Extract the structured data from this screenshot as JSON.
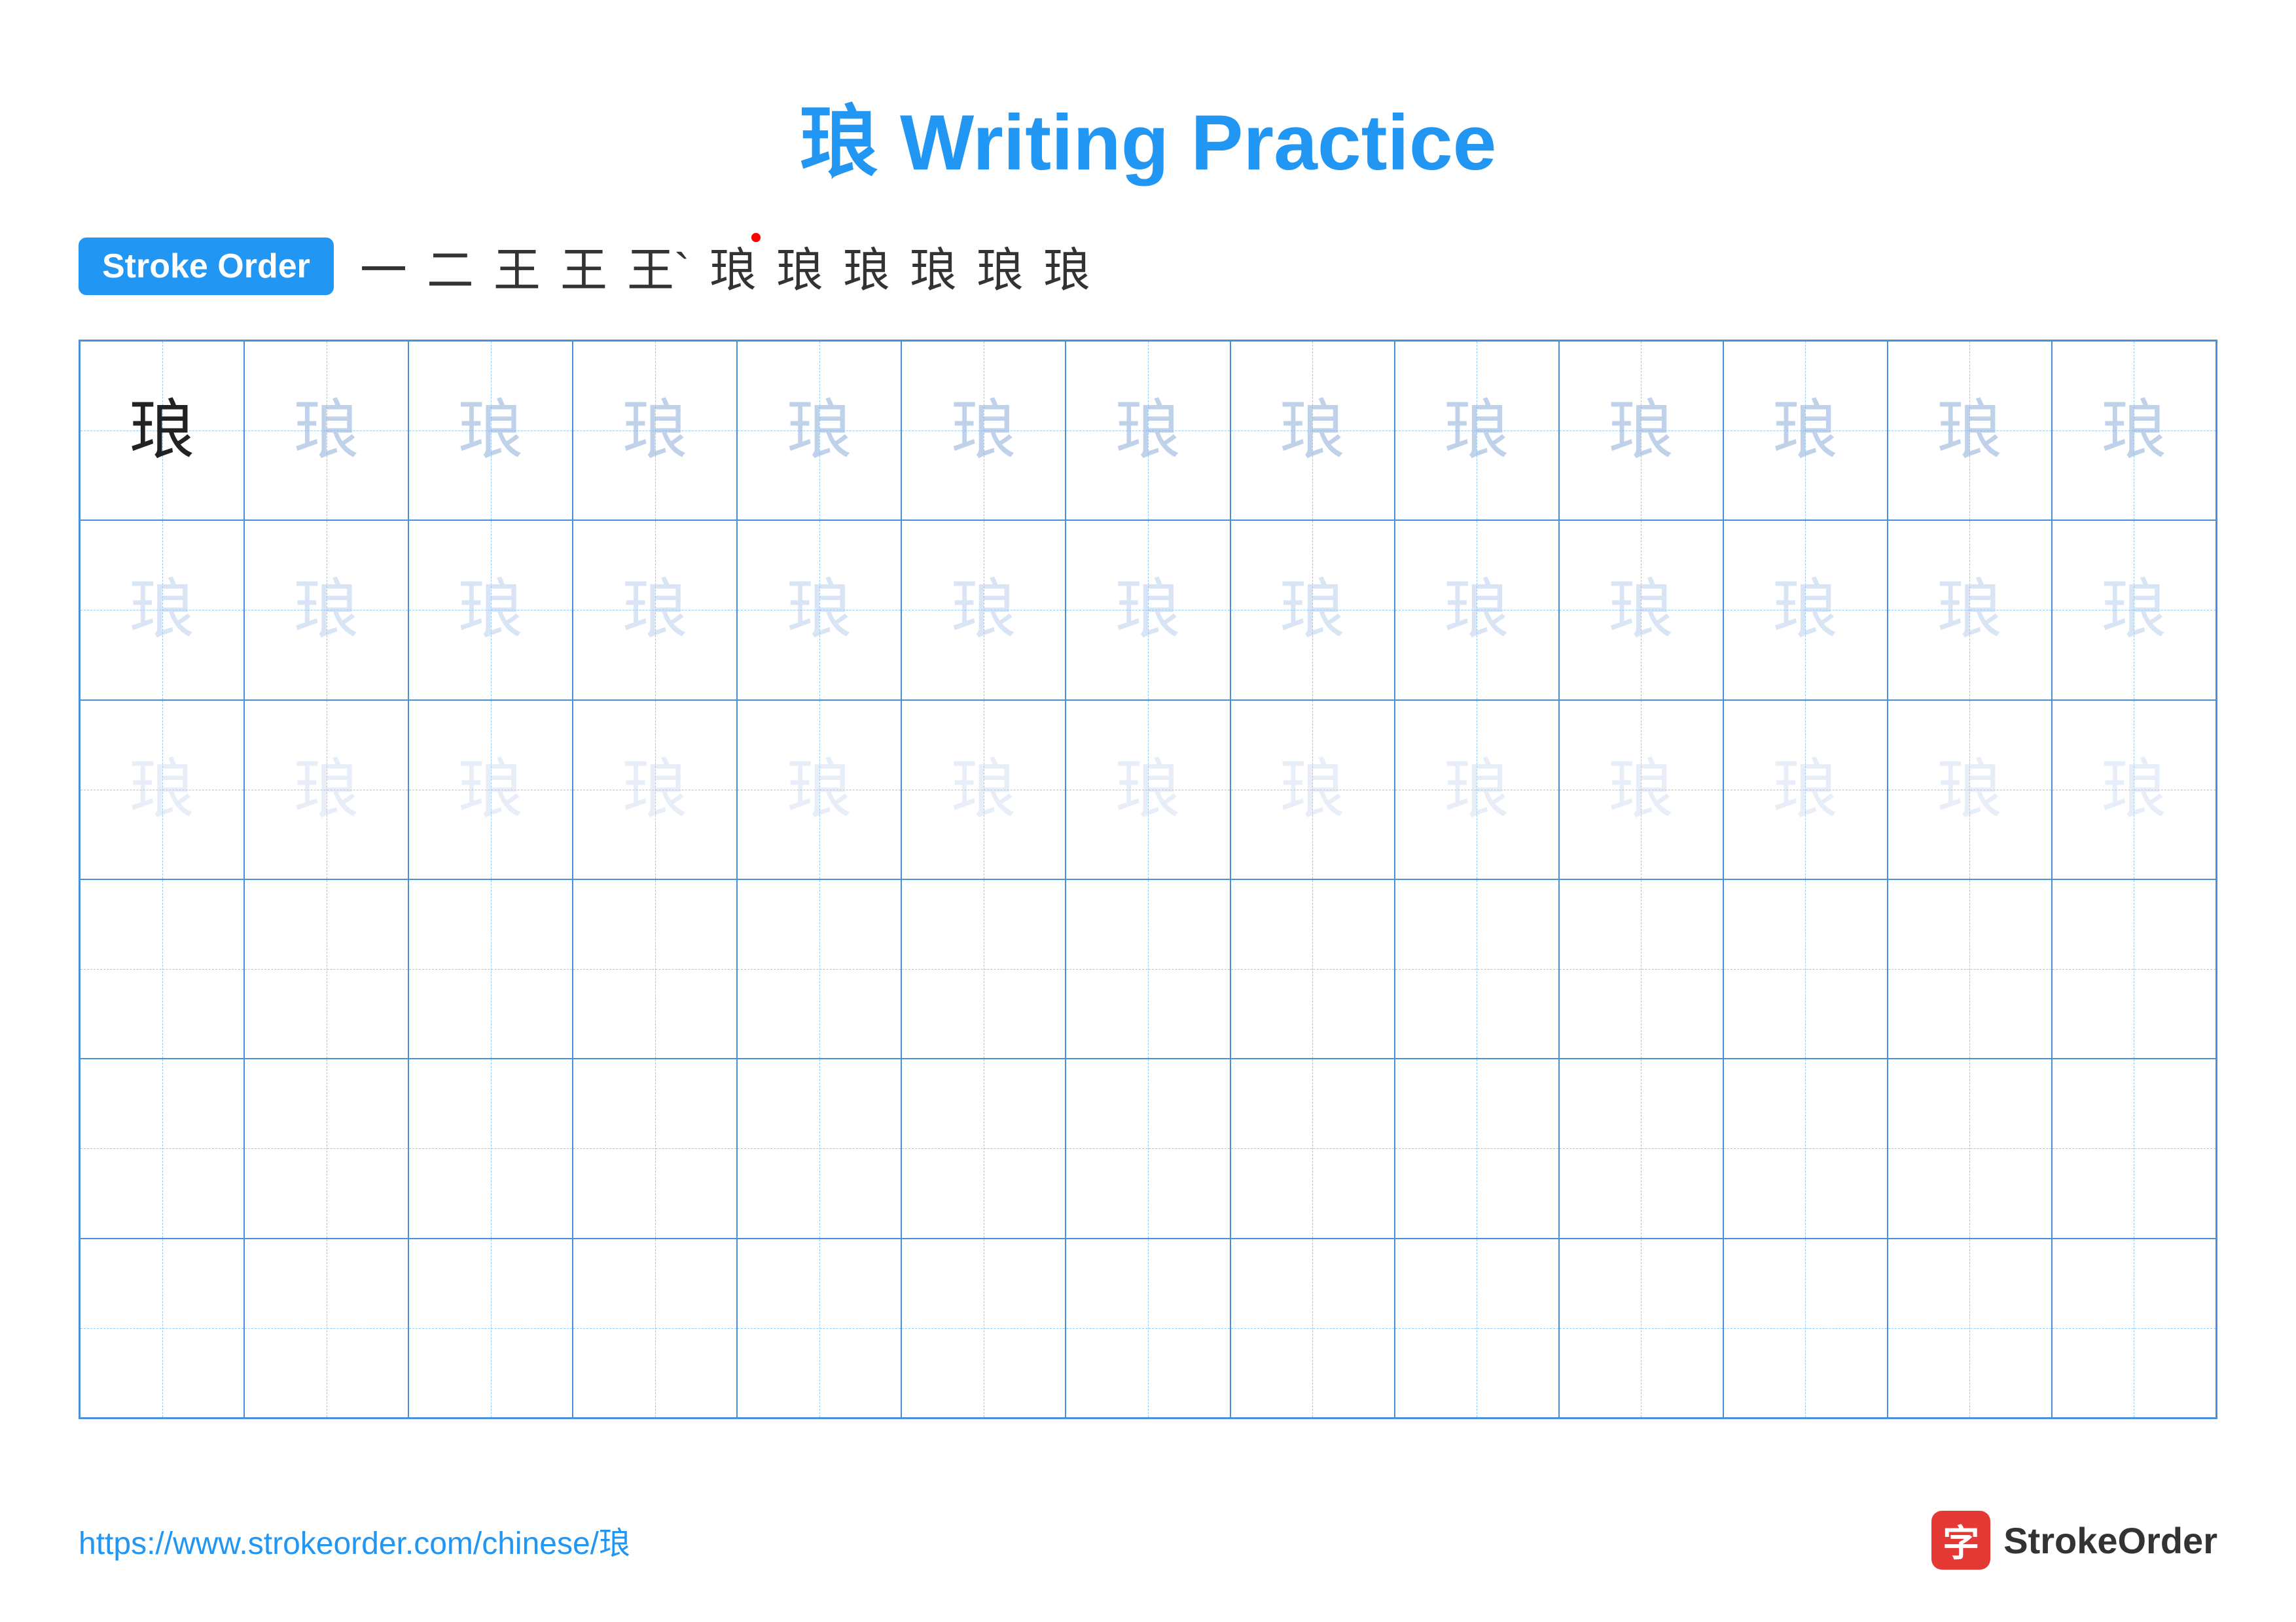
{
  "title": "琅 Writing Practice",
  "stroke_order": {
    "label": "Stroke Order",
    "strokes": [
      "一",
      "二",
      "王",
      "王",
      "王`",
      "琅",
      "琅",
      "琅",
      "琅",
      "琅",
      "琅"
    ]
  },
  "character": "琅",
  "grid": {
    "cols": 13,
    "rows": 6,
    "row_types": [
      "dark",
      "light1",
      "light2",
      "empty",
      "empty",
      "empty"
    ]
  },
  "footer": {
    "url": "https://www.strokeorder.com/chinese/琅",
    "brand": "StrokeOrder"
  }
}
